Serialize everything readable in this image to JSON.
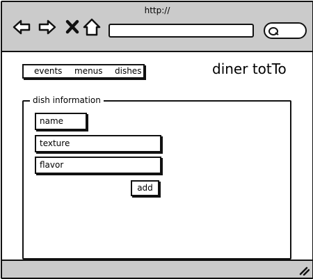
{
  "browser": {
    "url": "http://",
    "nav_icons": [
      "back-arrow-icon",
      "forward-arrow-icon",
      "close-x-icon",
      "home-icon"
    ],
    "search_icon": "search-icon",
    "resize_icon": "resize-grip-icon"
  },
  "menu": {
    "items": [
      {
        "label": "events"
      },
      {
        "label": "menus"
      },
      {
        "label": "dishes"
      }
    ]
  },
  "brand": {
    "title": "diner totTo"
  },
  "form": {
    "legend": "dish information",
    "fields": {
      "name": "name",
      "texture": "texture",
      "flavor": "flavor"
    },
    "add_label": "add"
  }
}
